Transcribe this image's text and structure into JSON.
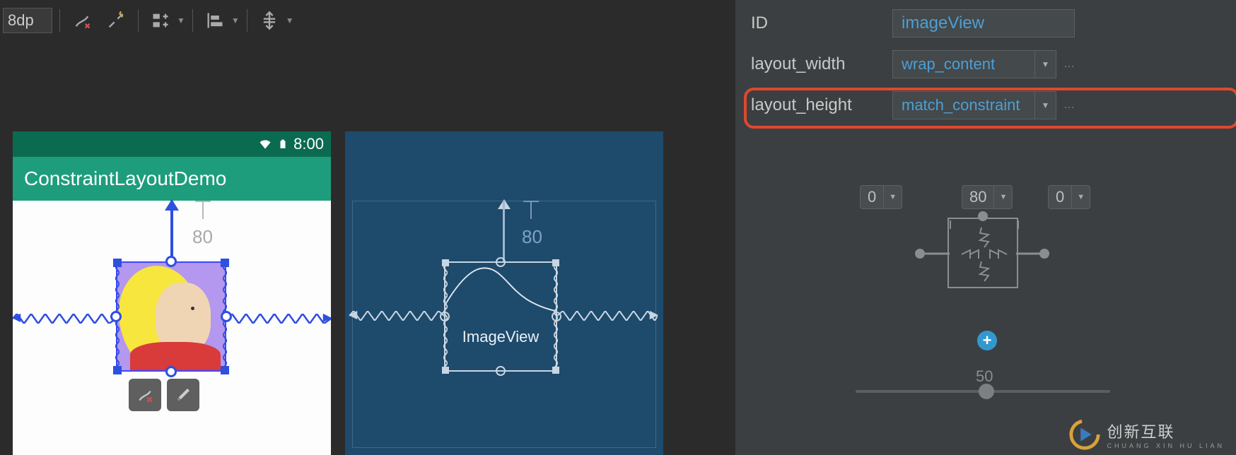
{
  "toolbar": {
    "default_margin": "8dp"
  },
  "phone": {
    "status_time": "8:00",
    "app_title": "ConstraintLayoutDemo",
    "top_margin": "80",
    "blueprint_label": "ImageView"
  },
  "attributes": {
    "id_label": "ID",
    "id_value": "imageView",
    "width_label": "layout_width",
    "width_value": "wrap_content",
    "height_label": "layout_height",
    "height_value": "match_constraint"
  },
  "constraint_widget": {
    "margin_top": "80",
    "margin_left": "0",
    "margin_right": "0",
    "bias_value": "50"
  },
  "watermark": {
    "brand": "创新互联",
    "sub": "CHUANG XIN HU LIAN"
  }
}
